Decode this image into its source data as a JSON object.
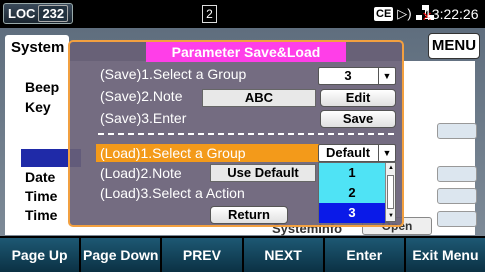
{
  "status": {
    "loc_label": "LOC",
    "address": "232",
    "page_indicator": "2",
    "ce_badge": "CE",
    "clock": "13:22:26",
    "icons": [
      "ce-badge-icon",
      "speaker-icon",
      "lan-disconnected-icon"
    ]
  },
  "background": {
    "tab_label": "System",
    "menu_label": "MENU",
    "labels": [
      "Beep",
      "Key",
      "Date",
      "Time",
      "Time"
    ],
    "system_info": "SystemInfo",
    "open_label": "Open"
  },
  "dialog": {
    "title": "Parameter Save&Load",
    "save": {
      "select_label": "(Save)1.Select a Group",
      "group_value": "3",
      "note_label": "(Save)2.Note",
      "note_value": "ABC",
      "edit_button": "Edit",
      "enter_label": "(Save)3.Enter",
      "save_button": "Save"
    },
    "load": {
      "select_label": "(Load)1.Select a Group",
      "group_value": "Default",
      "note_label": "(Load)2.Note",
      "note_value": "Use Default",
      "action_label": "(Load)3.Select a Action",
      "options": [
        "1",
        "2",
        "3"
      ],
      "highlighted_option": "3"
    },
    "return_button": "Return"
  },
  "softkeys": [
    "Page Up",
    "Page Down",
    "PREV",
    "NEXT",
    "Enter",
    "Exit Menu"
  ],
  "colors": {
    "dialog_border": "#f2a040",
    "title_bg": "#ff3ee8",
    "selected_row": "#f39a1a",
    "list_selected": "#0a1ae8",
    "list_hover": "#4fe3f5",
    "softkey_bg": "#1d5873"
  }
}
